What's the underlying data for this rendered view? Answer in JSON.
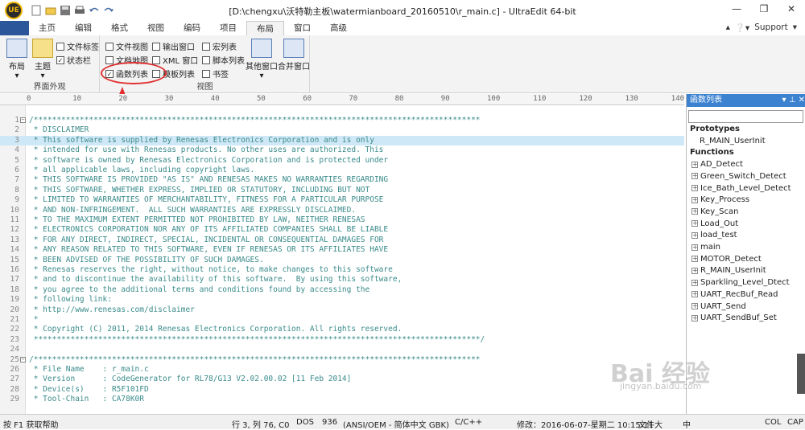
{
  "title": "[D:\\chengxu\\沃特勒主板\\watermianboard_20160510\\r_main.c] - UltraEdit 64-bit",
  "logo": "UE",
  "tabs": [
    "主页",
    "编辑",
    "格式",
    "视图",
    "编码",
    "项目",
    "布局",
    "窗口",
    "高级"
  ],
  "active_tab": "布局",
  "support": "Support",
  "ribbon": {
    "big_layout": "布局",
    "big_theme": "主题",
    "chk_file_tabs": "文件标签",
    "chk_statusbar": "状态栏",
    "group1_label": "界面外观",
    "chk_file_view": "文件视图",
    "chk_doc_map": "文档地图",
    "chk_func_list": "函数列表",
    "chk_output": "输出窗口",
    "chk_xml": "XML 窗口",
    "chk_template": "模板列表",
    "chk_macro": "宏列表",
    "chk_script": "脚本列表",
    "chk_bookmark": "书签",
    "big_other": "其他窗口",
    "big_merge": "合并窗口",
    "group2_label": "视图"
  },
  "ruler": [
    "0",
    "10",
    "20",
    "30",
    "40",
    "50",
    "60",
    "70",
    "80",
    "90",
    "100",
    "110",
    "120",
    "130",
    "140"
  ],
  "code_lines": [
    {
      "n": "1",
      "fold": "−",
      "text": "/*************************************************************************************************"
    },
    {
      "n": "2",
      "fold": "",
      "text": " * DISCLAIMER"
    },
    {
      "n": "3",
      "fold": "",
      "text": " * This software is supplied by Renesas Electronics Corporation and is only"
    },
    {
      "n": "4",
      "fold": "",
      "text": " * intended for use with Renesas products. No other uses are authorized. This"
    },
    {
      "n": "5",
      "fold": "",
      "text": " * software is owned by Renesas Electronics Corporation and is protected under"
    },
    {
      "n": "6",
      "fold": "",
      "text": " * all applicable laws, including copyright laws."
    },
    {
      "n": "7",
      "fold": "",
      "text": " * THIS SOFTWARE IS PROVIDED \"AS IS\" AND RENESAS MAKES NO WARRANTIES REGARDING"
    },
    {
      "n": "8",
      "fold": "",
      "text": " * THIS SOFTWARE, WHETHER EXPRESS, IMPLIED OR STATUTORY, INCLUDING BUT NOT"
    },
    {
      "n": "9",
      "fold": "",
      "text": " * LIMITED TO WARRANTIES OF MERCHANTABILITY, FITNESS FOR A PARTICULAR PURPOSE"
    },
    {
      "n": "10",
      "fold": "",
      "text": " * AND NON-INFRINGEMENT.  ALL SUCH WARRANTIES ARE EXPRESSLY DISCLAIMED."
    },
    {
      "n": "11",
      "fold": "",
      "text": " * TO THE MAXIMUM EXTENT PERMITTED NOT PROHIBITED BY LAW, NEITHER RENESAS"
    },
    {
      "n": "12",
      "fold": "",
      "text": " * ELECTRONICS CORPORATION NOR ANY OF ITS AFFILIATED COMPANIES SHALL BE LIABLE"
    },
    {
      "n": "13",
      "fold": "",
      "text": " * FOR ANY DIRECT, INDIRECT, SPECIAL, INCIDENTAL OR CONSEQUENTIAL DAMAGES FOR"
    },
    {
      "n": "14",
      "fold": "",
      "text": " * ANY REASON RELATED TO THIS SOFTWARE, EVEN IF RENESAS OR ITS AFFILIATES HAVE"
    },
    {
      "n": "15",
      "fold": "",
      "text": " * BEEN ADVISED OF THE POSSIBILITY OF SUCH DAMAGES."
    },
    {
      "n": "16",
      "fold": "",
      "text": " * Renesas reserves the right, without notice, to make changes to this software"
    },
    {
      "n": "17",
      "fold": "",
      "text": " * and to discontinue the availability of this software.  By using this software,"
    },
    {
      "n": "18",
      "fold": "",
      "text": " * you agree to the additional terms and conditions found by accessing the"
    },
    {
      "n": "19",
      "fold": "",
      "text": " * following link:"
    },
    {
      "n": "20",
      "fold": "",
      "text": " * http://www.renesas.com/disclaimer"
    },
    {
      "n": "21",
      "fold": "",
      "text": " *"
    },
    {
      "n": "22",
      "fold": "",
      "text": " * Copyright (C) 2011, 2014 Renesas Electronics Corporation. All rights reserved."
    },
    {
      "n": "23",
      "fold": "",
      "text": " *************************************************************************************************/"
    },
    {
      "n": "24",
      "fold": "",
      "text": ""
    },
    {
      "n": "25",
      "fold": "−",
      "text": "/*************************************************************************************************"
    },
    {
      "n": "26",
      "fold": "",
      "text": " * File Name    : r_main.c"
    },
    {
      "n": "27",
      "fold": "",
      "text": " * Version      : CodeGenerator for RL78/G13 V2.02.00.02 [11 Feb 2014]"
    },
    {
      "n": "28",
      "fold": "",
      "text": " * Device(s)    : R5F101FD"
    },
    {
      "n": "29",
      "fold": "",
      "text": " * Tool-Chain   : CA78K0R"
    }
  ],
  "panel": {
    "title": "函数列表",
    "prototypes_label": "Prototypes",
    "prototypes": [
      "R_MAIN_UserInit"
    ],
    "functions_label": "Functions",
    "functions": [
      "AD_Detect",
      "Green_Switch_Detect",
      "Ice_Bath_Level_Detect",
      "Key_Process",
      "Key_Scan",
      "Load_Out",
      "load_test",
      "main",
      "MOTOR_Detect",
      "R_MAIN_UserInit",
      "Sparkling_Level_Dtect",
      "UART_RecBuf_Read",
      "UART_Send",
      "UART_SendBuf_Set"
    ]
  },
  "status": {
    "help": "按 F1 获取帮助",
    "pos": "行 3, 列 76, C0",
    "eol": "DOS",
    "codepage": "936",
    "encoding": "(ANSI/OEM - 简体中文 GBK)",
    "lang": "C/C++",
    "modified": "修改：2016-06-07-星期二 10:15:11",
    "filesize": "文件大",
    "ime": "中",
    "col": "COL",
    "cap": "CAP"
  },
  "watermark": "Bai 经验",
  "watermark_url": "jingyan.baidu.com"
}
